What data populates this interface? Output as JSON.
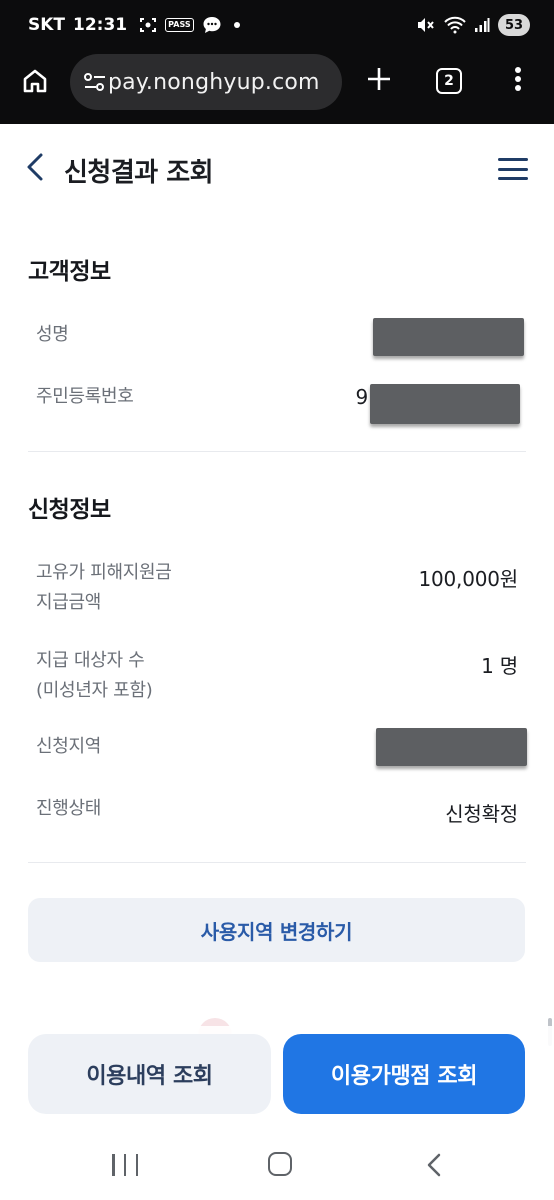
{
  "status_bar": {
    "carrier": "SKT",
    "time": "12:31",
    "pass_label": "PASS",
    "battery": "53"
  },
  "browser": {
    "url": "pay.nonghyup.com",
    "tab_count": "2"
  },
  "header": {
    "title": "신청결과 조회"
  },
  "customer_info": {
    "section_title": "고객정보",
    "name_label": "성명",
    "id_label": "주민등록번호",
    "id_value_visible": "9"
  },
  "application_info": {
    "section_title": "신청정보",
    "amount_label_line1": "고유가 피해지원금",
    "amount_label_line2": "지급금액",
    "amount_value": "100,000원",
    "recipients_label_line1": "지급 대상자 수",
    "recipients_label_line2": "(미성년자 포함)",
    "recipients_value": "1 명",
    "region_label": "신청지역",
    "status_label": "진행상태",
    "status_value": "신청확정"
  },
  "buttons": {
    "change_region": "사용지역 변경하기",
    "usage_history": "이용내역 조회",
    "merchant_search": "이용가맹점 조회"
  },
  "icons": {
    "home": "home-icon",
    "site_info": "site-info-icon",
    "new_tab": "plus-icon",
    "more": "more-vert-icon",
    "back": "chevron-left-icon",
    "menu": "hamburger-icon"
  },
  "colors": {
    "primary": "#2076e4",
    "secondary_bg": "#eef1f6",
    "link_text": "#2a5ba8"
  }
}
